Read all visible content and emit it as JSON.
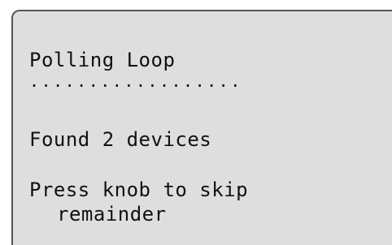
{
  "screen": {
    "title": "Polling Loop",
    "progress_dots": "..................",
    "status": "Found 2 devices",
    "prompt_line1": "Press knob to skip",
    "prompt_line2": "remainder"
  },
  "colors": {
    "screen_background": "#dedede",
    "text": "#111111",
    "border": "#555555"
  }
}
